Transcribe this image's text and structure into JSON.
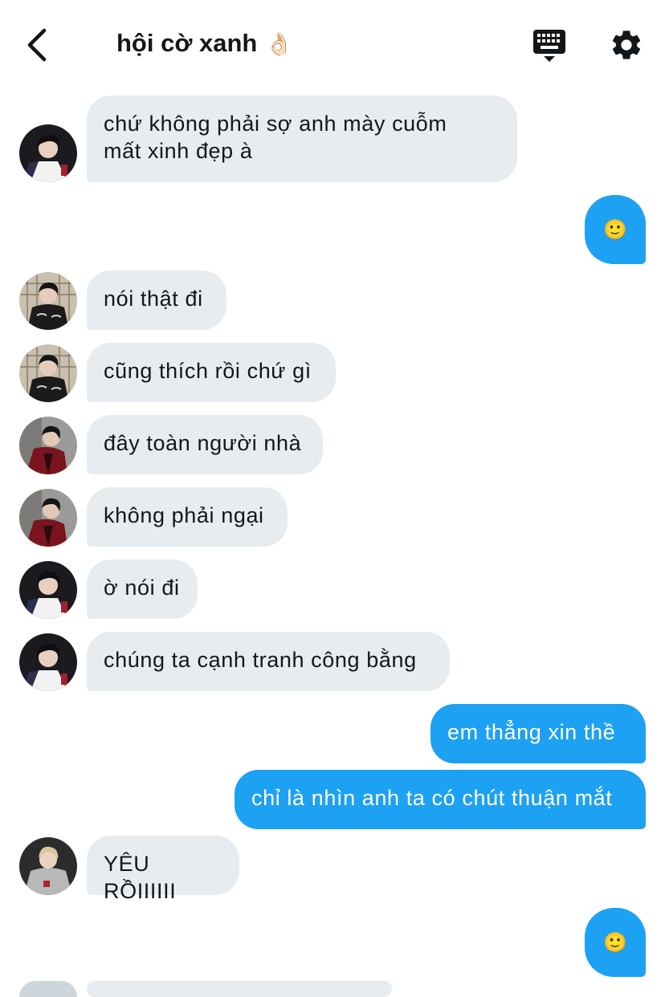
{
  "header": {
    "title": "hội cờ xanh",
    "title_emoji": "👌🏻",
    "back_icon": "chevron-left-icon",
    "keyboard_icon": "keyboard-icon",
    "settings_icon": "gear-icon"
  },
  "colors": {
    "incoming_bubble": "#e6ecf0",
    "outgoing_bubble": "#1da1f2",
    "text": "#14171a"
  },
  "messages": [
    {
      "side": "in",
      "avatar": "avatar-dark-hair-user",
      "text": "chứ không phải sợ anh mày cuỗm\nmất xinh đẹp à"
    },
    {
      "side": "out",
      "emoji": "🙂"
    },
    {
      "side": "in",
      "avatar": "avatar-black-jacket-user",
      "text": "nói thật đi"
    },
    {
      "side": "in",
      "avatar": "avatar-black-jacket-user",
      "text": "cũng thích rồi chứ gì"
    },
    {
      "side": "in",
      "avatar": "avatar-red-jacket-user",
      "text": "đây toàn người nhà"
    },
    {
      "side": "in",
      "avatar": "avatar-red-jacket-user",
      "text": "không phải ngại"
    },
    {
      "side": "in",
      "avatar": "avatar-dark-hair-user",
      "text": "ờ nói đi"
    },
    {
      "side": "in",
      "avatar": "avatar-dark-hair-user",
      "text": "chúng ta cạnh tranh công bằng"
    },
    {
      "side": "out",
      "text": "em thẳng xin thề"
    },
    {
      "side": "out",
      "text": "chỉ là nhìn anh ta có chút thuận mắt"
    },
    {
      "side": "in",
      "avatar": "avatar-grey-hoodie-user",
      "text": "YÊU RỒIIIIII"
    },
    {
      "side": "out",
      "emoji": "🙂"
    }
  ]
}
